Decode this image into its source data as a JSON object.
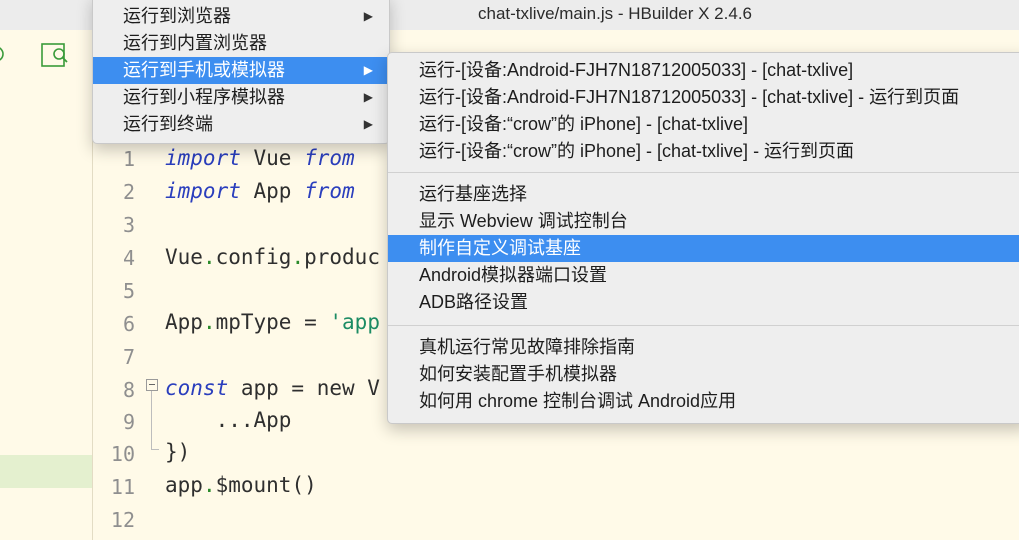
{
  "window": {
    "title": "chat-txlive/main.js - HBuilder X 2.4.6"
  },
  "toolbar": {
    "icons": [
      "forward-icon",
      "preview-icon"
    ]
  },
  "editor": {
    "line_numbers": [
      "1",
      "2",
      "3",
      "4",
      "5",
      "6",
      "7",
      "8",
      "9",
      "10",
      "11",
      "12"
    ],
    "lines": [
      {
        "kw": "import",
        "rest": " Vue ",
        "kw2": "from"
      },
      {
        "kw": "import",
        "rest": " App ",
        "kw2": "from"
      },
      {
        "text": ""
      },
      {
        "a": "Vue",
        "b": "config",
        "c": "produc"
      },
      {
        "text": ""
      },
      {
        "a": "App",
        "b": "mpType = ",
        "s": "'app"
      },
      {
        "text": ""
      },
      {
        "kw": "const",
        "rest": " app = new V"
      },
      {
        "text": "    ...App"
      },
      {
        "text": "})"
      },
      {
        "a": "app",
        "b": "$mount()"
      },
      {
        "text": ""
      }
    ]
  },
  "menu_run": {
    "items": [
      {
        "label": "运行到浏览器",
        "arrow": "▶",
        "selected": false
      },
      {
        "label": "运行到内置浏览器",
        "arrow": "",
        "selected": false
      },
      {
        "label": "运行到手机或模拟器",
        "arrow": "▶",
        "selected": true
      },
      {
        "label": "运行到小程序模拟器",
        "arrow": "▶",
        "selected": false
      },
      {
        "label": "运行到终端",
        "arrow": "▶",
        "selected": false
      }
    ]
  },
  "menu_device": {
    "group1": [
      "运行-[设备:Android-FJH7N18712005033] - [chat-txlive]",
      "运行-[设备:Android-FJH7N18712005033] - [chat-txlive] - 运行到页面",
      "运行-[设备:“crow”的 iPhone] - [chat-txlive]",
      "运行-[设备:“crow”的 iPhone] - [chat-txlive] - 运行到页面"
    ],
    "group2": [
      "运行基座选择",
      "显示 Webview 调试控制台",
      "制作自定义调试基座",
      "Android模拟器端口设置",
      "ADB路径设置"
    ],
    "group3": [
      "真机运行常见故障排除指南",
      "如何安装配置手机模拟器",
      "如何用 chrome 控制台调试 Android应用"
    ],
    "selected": "制作自定义调试基座"
  },
  "colors": {
    "selection": "#3d8ef0",
    "editor_bg": "#fffae8",
    "keyword": "#2a3ebd"
  }
}
